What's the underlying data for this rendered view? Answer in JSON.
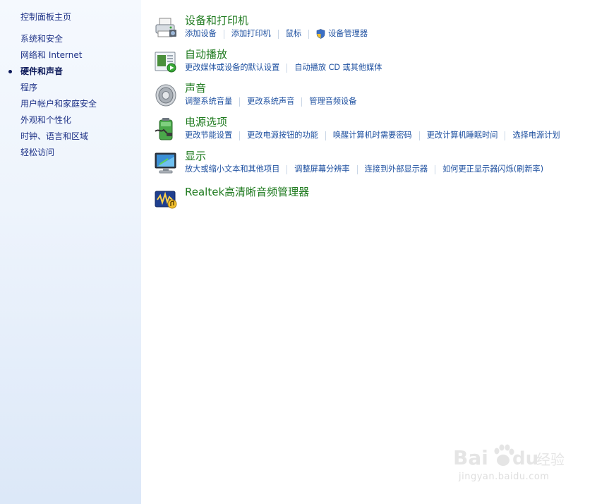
{
  "nav": {
    "home": "控制面板主页",
    "items": [
      {
        "label": "系统和安全",
        "active": false
      },
      {
        "label": "网络和 Internet",
        "active": false
      },
      {
        "label": "硬件和声音",
        "active": true
      },
      {
        "label": "程序",
        "active": false
      },
      {
        "label": "用户帐户和家庭安全",
        "active": false
      },
      {
        "label": "外观和个性化",
        "active": false
      },
      {
        "label": "时钟、语言和区域",
        "active": false
      },
      {
        "label": "轻松访问",
        "active": false
      }
    ]
  },
  "categories": [
    {
      "title": "设备和打印机",
      "icon": "printer-icon",
      "links": [
        "添加设备",
        "添加打印机",
        "鼠标",
        "设备管理器"
      ],
      "shield_link_index": 3
    },
    {
      "title": "自动播放",
      "icon": "autoplay-icon",
      "links": [
        "更改媒体或设备的默认设置",
        "自动播放 CD 或其他媒体"
      ]
    },
    {
      "title": "声音",
      "icon": "speaker-icon",
      "links": [
        "调整系统音量",
        "更改系统声音",
        "管理音频设备"
      ]
    },
    {
      "title": "电源选项",
      "icon": "battery-icon",
      "links": [
        "更改节能设置",
        "更改电源按钮的功能",
        "唤醒计算机时需要密码",
        "更改计算机睡眠时间",
        "选择电源计划"
      ]
    },
    {
      "title": "显示",
      "icon": "monitor-icon",
      "links": [
        "放大或缩小文本和其他项目",
        "调整屏幕分辨率",
        "连接到外部显示器",
        "如何更正显示器闪烁(刷新率)"
      ]
    },
    {
      "title": "Realtek高清晰音频管理器",
      "icon": "realtek-audio-icon",
      "links": []
    }
  ],
  "watermark": {
    "brand": "Bai du 经验",
    "url": "jingyan.baidu.com"
  },
  "colors": {
    "title_green": "#1e7a1e",
    "link_blue": "#1e50a0",
    "nav_blue": "#1e3287"
  }
}
